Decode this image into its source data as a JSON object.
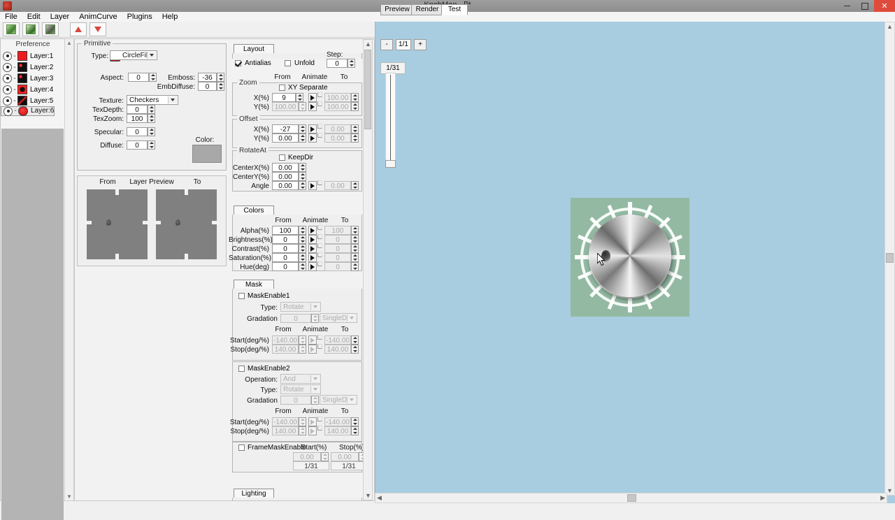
{
  "window": {
    "title": "KnobMan - []*",
    "icon": "app-icon",
    "minimize": "–",
    "maximize": "❐",
    "close": "✕"
  },
  "menubar": {
    "items": [
      "File",
      "Edit",
      "Layer",
      "AnimCurve",
      "Plugins",
      "Help"
    ]
  },
  "toolbar": {
    "buttons": [
      {
        "name": "new-layer-icon",
        "label": ""
      },
      {
        "name": "duplicate-layer-icon",
        "label": ""
      },
      {
        "name": "delete-layer-icon",
        "label": ""
      },
      {
        "name": "move-layer-up-icon",
        "label": ""
      },
      {
        "name": "move-layer-down-icon",
        "label": ""
      }
    ]
  },
  "layers": {
    "header": "Preference",
    "items": [
      {
        "name": "Layer:1",
        "color": "#ee1c1c"
      },
      {
        "name": "Layer:2",
        "color": "#1a1a1a"
      },
      {
        "name": "Layer:3",
        "color": "#1a1a1a"
      },
      {
        "name": "Layer:4",
        "color": "#1a1a1a"
      },
      {
        "name": "Layer:5",
        "color": "#1a1a1a"
      },
      {
        "name": "Layer:6",
        "color": "#1a1a1a"
      }
    ],
    "selected_index": 5
  },
  "primitive": {
    "legend": "Primitive",
    "type_label": "Type:",
    "type_value": "CircleFill",
    "aspect_label": "Aspect:",
    "aspect_value": "0",
    "emboss_label": "Emboss:",
    "emboss_value": "-36",
    "embdiffuse_label": "EmbDiffuse:",
    "embdiffuse_value": "0",
    "texture_label": "Texture:",
    "texture_value": "Checkers",
    "texdepth_label": "TexDepth:",
    "texdepth_value": "0",
    "texzoom_label": "TexZoom:",
    "texzoom_value": "100",
    "specular_label": "Specular:",
    "specular_value": "0",
    "diffuse_label": "Diffuse:",
    "diffuse_value": "0",
    "color_label": "Color:",
    "color_value": "#a8a8a8"
  },
  "layer_preview": {
    "from_label": "From",
    "title": "Layer Preview",
    "to_label": "To"
  },
  "layout": {
    "tab_label": "Layout",
    "antialias_label": "Antialias",
    "antialias_checked": true,
    "unfold_label": "Unfold",
    "unfold_checked": false,
    "step_label": "Step:",
    "step_value": "0",
    "col_from": "From",
    "col_animate": "Animate",
    "col_to": "To",
    "zoom": {
      "legend": "Zoom",
      "xy_separate_label": "XY Separate",
      "xy_separate_checked": false,
      "rows": [
        {
          "label": "X(%)",
          "from": "9",
          "to": "100.00",
          "to_disabled": true
        },
        {
          "label": "Y(%)",
          "from": "100.00",
          "from_disabled": true,
          "to": "100.00",
          "to_disabled": true
        }
      ]
    },
    "offset": {
      "legend": "Offset",
      "rows": [
        {
          "label": "X(%)",
          "from": "-27",
          "to": "0.00",
          "to_disabled": true
        },
        {
          "label": "Y(%)",
          "from": "0.00",
          "to": "0.00",
          "to_disabled": true
        }
      ]
    },
    "rotateat": {
      "legend": "RotateAt",
      "keepdir_label": "KeepDir",
      "keepdir_checked": false,
      "rows": [
        {
          "label": "CenterX(%)",
          "from": "0.00",
          "has_anim": false
        },
        {
          "label": "CenterY(%)",
          "from": "0.00",
          "has_anim": false
        },
        {
          "label": "Angle",
          "from": "0.00",
          "has_anim": true,
          "to": "0.00",
          "to_disabled": true
        }
      ]
    }
  },
  "colors": {
    "tab_label": "Colors",
    "col_from": "From",
    "col_animate": "Animate",
    "col_to": "To",
    "rows": [
      {
        "label": "Alpha(%)",
        "from": "100",
        "to": "100"
      },
      {
        "label": "Brightness(%)",
        "from": "0",
        "to": "0"
      },
      {
        "label": "Contrast(%)",
        "from": "0",
        "to": "0"
      },
      {
        "label": "Saturation(%)",
        "from": "0",
        "to": "0"
      },
      {
        "label": "Hue(deg)",
        "from": "0",
        "to": "0"
      }
    ]
  },
  "mask": {
    "tab_label": "Mask",
    "mask1": {
      "enable_label": "MaskEnable1",
      "enabled": false,
      "type_label": "Type:",
      "type_value": "Rotate",
      "gradation_label": "Gradation",
      "gradation_value": "0",
      "gradation_mode": "SingleDir",
      "col_from": "From",
      "col_animate": "Animate",
      "col_to": "To",
      "rows": [
        {
          "label": "Start(deg/%)",
          "from": "-140.00",
          "to": "-140.00"
        },
        {
          "label": "Stop(deg/%)",
          "from": "140.00",
          "to": "140.00"
        }
      ]
    },
    "mask2": {
      "enable_label": "MaskEnable2",
      "enabled": false,
      "operation_label": "Operation:",
      "operation_value": "And",
      "type_label": "Type:",
      "type_value": "Rotate",
      "gradation_label": "Gradation",
      "gradation_value": "0",
      "gradation_mode": "SingleDir",
      "col_from": "From",
      "col_animate": "Animate",
      "col_to": "To",
      "rows": [
        {
          "label": "Start(deg/%)",
          "from": "-140.00",
          "to": "-140.00"
        },
        {
          "label": "Stop(deg/%)",
          "from": "140.00",
          "to": "140.00"
        }
      ]
    },
    "framemask": {
      "enable_label": "FrameMaskEnable",
      "enabled": false,
      "start_label": "Start(%)",
      "start_value": "0.00",
      "start_frame": "1/31",
      "stop_label": "Stop(%)",
      "stop_value": "0.00",
      "stop_frame": "1/31"
    }
  },
  "lighting": {
    "tab_label": "Lighting"
  },
  "preview": {
    "tabs": [
      {
        "label": "Preview",
        "active": false
      },
      {
        "label": "Render",
        "active": false
      },
      {
        "label": "Test",
        "active": true
      }
    ],
    "zoom_out_label": "-",
    "zoom_value": "1/1",
    "zoom_in_label": "+",
    "frame_label": "1/31",
    "background_color": "#a8cde0",
    "knob_background": "#93b9a3"
  }
}
